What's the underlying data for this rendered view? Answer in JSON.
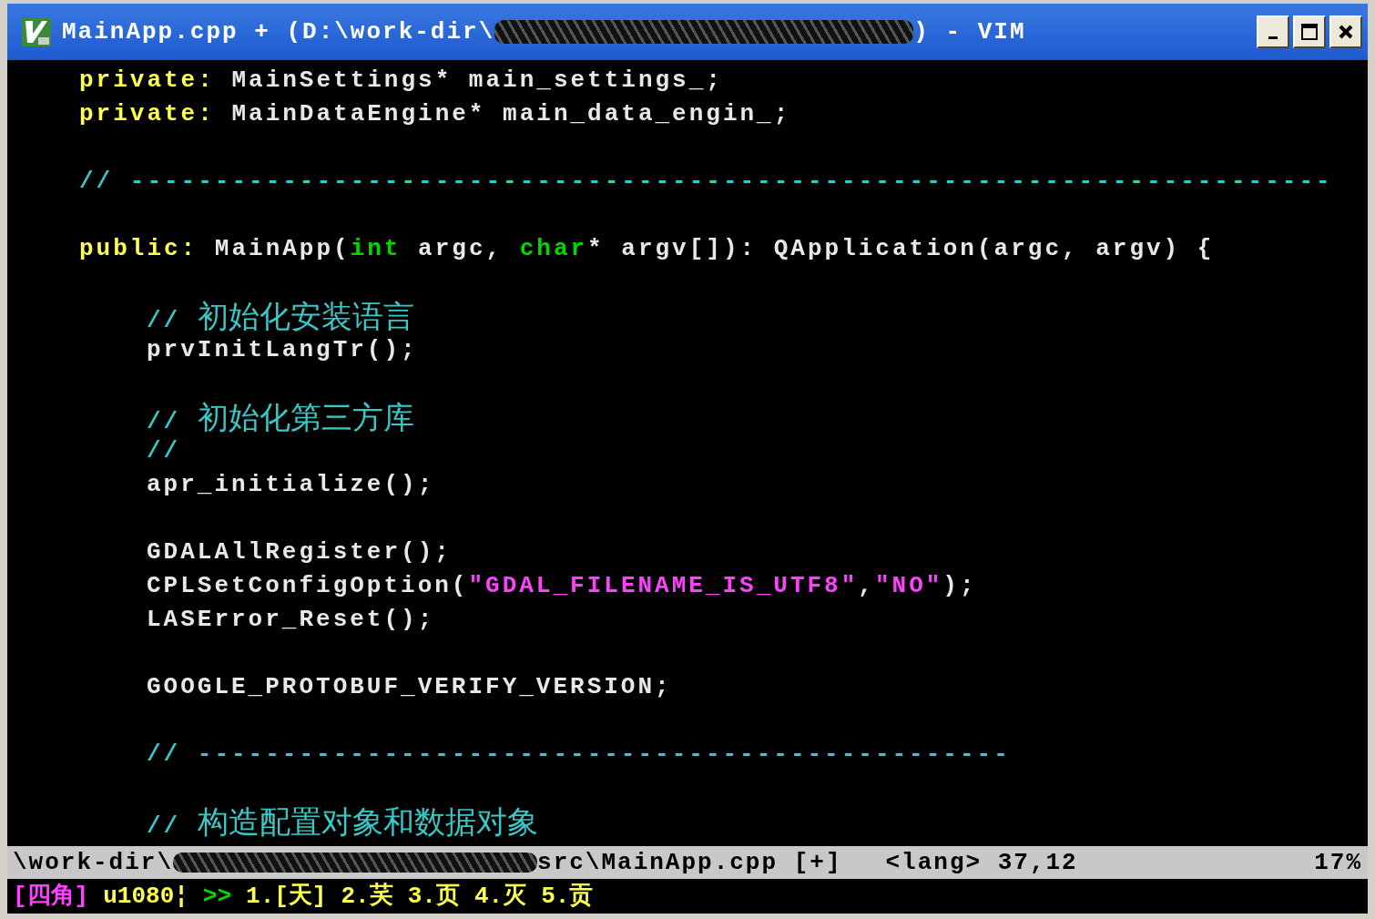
{
  "window": {
    "title_start": "MainApp.cpp + (D:\\work-dir\\",
    "title_end": ") - VIM"
  },
  "blocks": [
    {
      "lines": [
        {
          "segments": [
            {
              "kind": "keyword",
              "text": "private:"
            },
            {
              "kind": "plain",
              "text": " MainSettings* main_settings_;"
            }
          ]
        },
        {
          "segments": [
            {
              "kind": "keyword",
              "text": "private:"
            },
            {
              "kind": "plain",
              "text": " MainDataEngine* main_data_engin_;"
            }
          ]
        }
      ]
    },
    {
      "lines": [
        {
          "segments": [
            {
              "kind": "comment",
              "text": "// -----------------------------------------------------------------------"
            }
          ]
        }
      ]
    },
    {
      "lines": [
        {
          "segments": [
            {
              "kind": "keyword",
              "text": "public:"
            },
            {
              "kind": "plain",
              "text": " MainApp("
            },
            {
              "kind": "type",
              "text": "int"
            },
            {
              "kind": "plain",
              "text": " argc, "
            },
            {
              "kind": "type",
              "text": "char"
            },
            {
              "kind": "plain",
              "text": "* argv[]): QApplication(argc, argv) {"
            }
          ]
        }
      ],
      "children": [
        {
          "lines": [
            {
              "segments": [
                {
                  "kind": "comment",
                  "text": "// "
                },
                {
                  "kind": "comment_cjk",
                  "text": "初始化安装语言"
                }
              ]
            },
            {
              "segments": [
                {
                  "kind": "plain",
                  "text": "prvInitLangTr();"
                }
              ]
            }
          ]
        },
        {
          "lines": [
            {
              "segments": [
                {
                  "kind": "comment",
                  "text": "// "
                },
                {
                  "kind": "comment_cjk",
                  "text": "初始化第三方库"
                }
              ]
            },
            {
              "segments": [
                {
                  "kind": "comment",
                  "text": "//"
                }
              ]
            },
            {
              "segments": [
                {
                  "kind": "plain",
                  "text": "apr_initialize();"
                }
              ]
            }
          ]
        },
        {
          "lines": [
            {
              "segments": [
                {
                  "kind": "plain",
                  "text": "GDALAllRegister();"
                }
              ]
            },
            {
              "segments": [
                {
                  "kind": "plain",
                  "text": "CPLSetConfigOption("
                },
                {
                  "kind": "string",
                  "text": "\"GDAL_FILENAME_IS_UTF8\""
                },
                {
                  "kind": "plain",
                  "text": ","
                },
                {
                  "kind": "string",
                  "text": "\"NO\""
                },
                {
                  "kind": "plain",
                  "text": ");"
                }
              ]
            },
            {
              "segments": [
                {
                  "kind": "plain",
                  "text": "LASError_Reset();"
                }
              ]
            }
          ]
        },
        {
          "lines": [
            {
              "segments": [
                {
                  "kind": "plain",
                  "text": "GOOGLE_PROTOBUF_VERIFY_VERSION;"
                }
              ]
            }
          ]
        },
        {
          "lines": [
            {
              "segments": [
                {
                  "kind": "comment",
                  "text": "// ------------------------------------------------"
                }
              ]
            }
          ]
        },
        {
          "lines": [
            {
              "segments": [
                {
                  "kind": "comment",
                  "text": "// "
                },
                {
                  "kind": "comment_cjk",
                  "text": "构造配置对象和数据对象"
                }
              ]
            }
          ]
        }
      ]
    }
  ],
  "status_bar": {
    "path_start": "\\work-dir\\",
    "path_end": "src\\MainApp.cpp [+]",
    "position": "<lang> 37,12",
    "percent": "17%"
  },
  "ime_bar": [
    {
      "kind": "mode",
      "text": "[四角]"
    },
    {
      "kind": "code",
      "text": "u1080¦"
    },
    {
      "kind": "arrow",
      "text": ">>"
    },
    {
      "kind": "number",
      "text": "1.[天]"
    },
    {
      "kind": "number",
      "text": "2.芺"
    },
    {
      "kind": "number",
      "text": "3.页"
    },
    {
      "kind": "number",
      "text": "4.灭"
    },
    {
      "kind": "number",
      "text": "5.贡"
    }
  ]
}
